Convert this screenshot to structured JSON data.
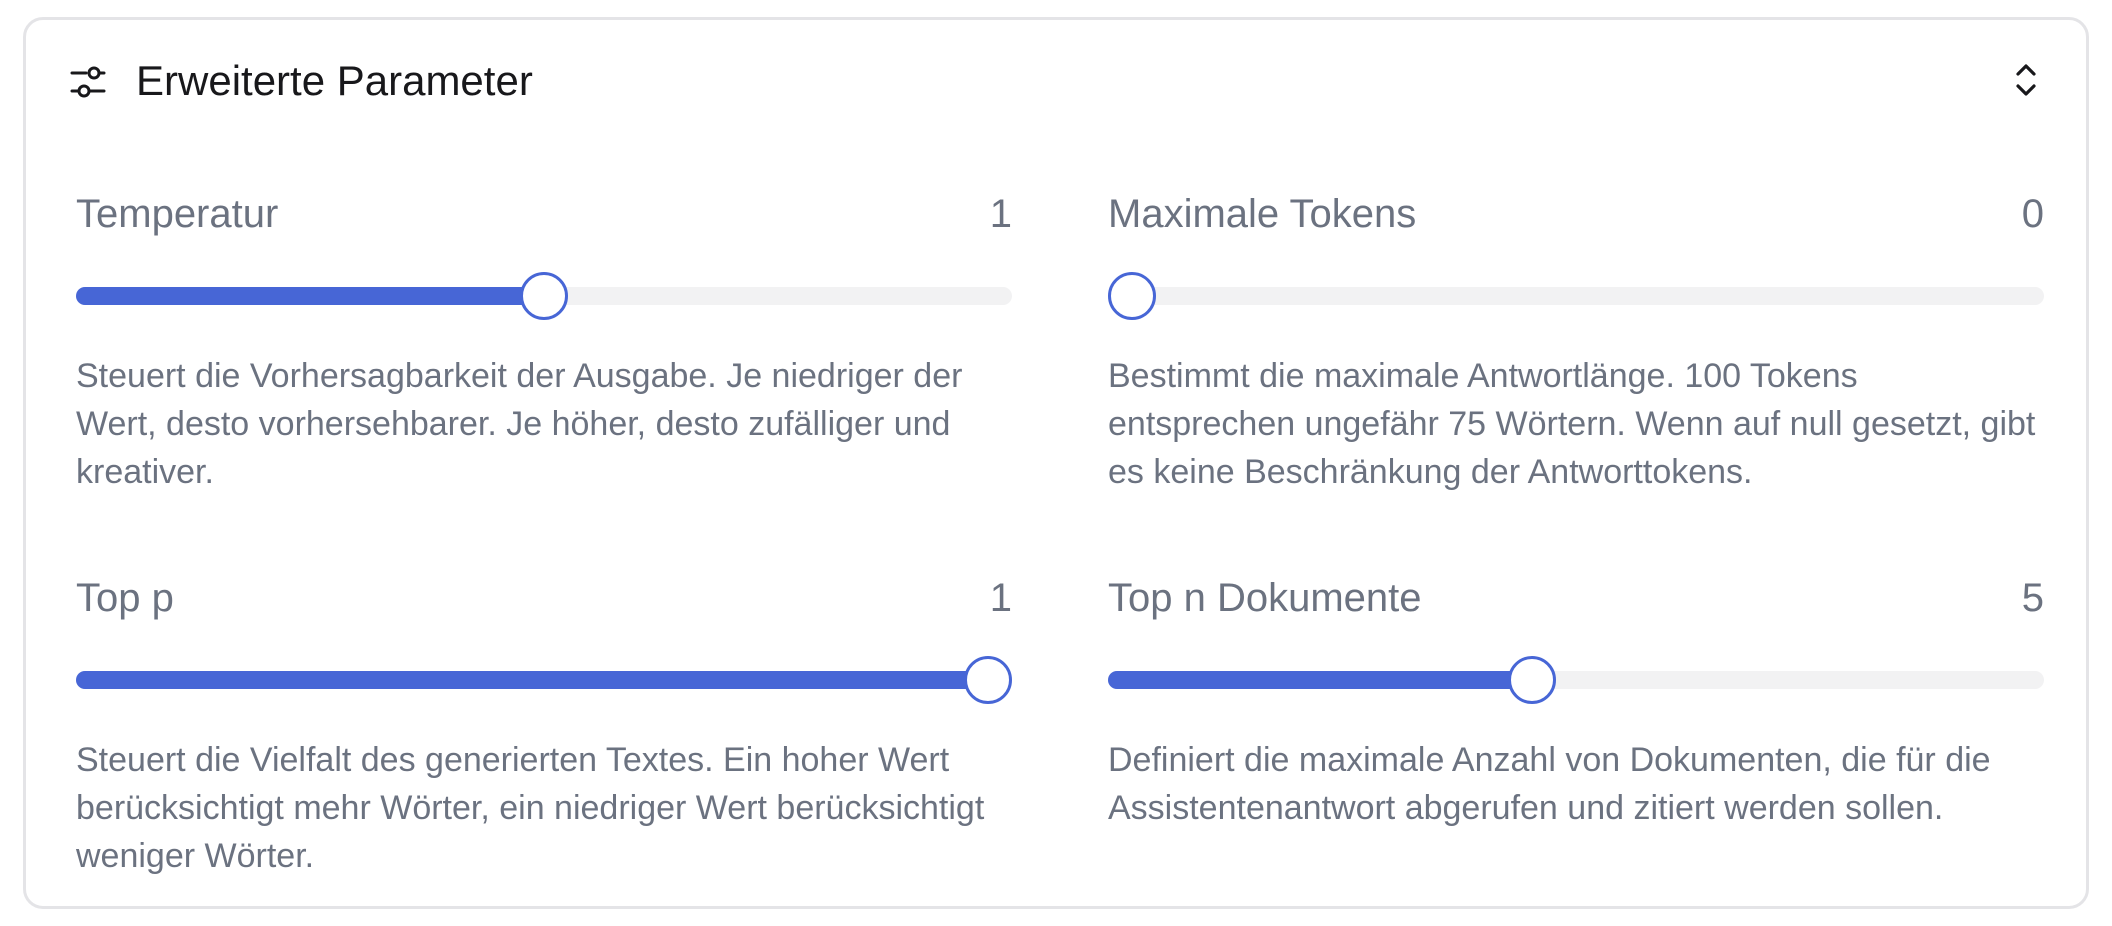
{
  "panel": {
    "title": "Erweiterte Parameter",
    "header_icon": "sliders-icon",
    "toggle_icon": "chevron-up-down-icon"
  },
  "accent_color": "#4766d6",
  "track_color": "#f2f2f3",
  "params": {
    "temperature": {
      "label": "Temperatur",
      "value": "1",
      "level": 0.5,
      "description": "Steuert die Vorhersagbarkeit der Ausgabe. Je niedriger der Wert, desto vorhersehbarer. Je höher, desto zufälliger und kreativer."
    },
    "max_tokens": {
      "label": "Maximale Tokens",
      "value": "0",
      "level": 0,
      "description": "Bestimmt die maximale Antwortlänge. 100 Tokens entsprechen ungefähr 75 Wörtern. Wenn auf null gesetzt, gibt es keine Beschränkung der Antworttokens."
    },
    "top_p": {
      "label": "Top p",
      "value": "1",
      "level": 1,
      "description": "Steuert die Vielfalt des generierten Textes. Ein hoher Wert berücksichtigt mehr Wörter, ein niedriger Wert berücksichtigt weniger Wörter."
    },
    "top_n": {
      "label": "Top n Dokumente",
      "value": "5",
      "level": 0.45,
      "description": "Definiert die maximale Anzahl von Dokumenten, die für die Assistentenantwort abgerufen und zitiert werden sollen."
    }
  }
}
